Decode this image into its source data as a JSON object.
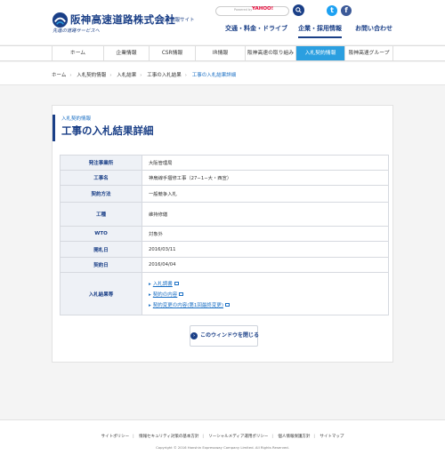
{
  "header": {
    "logo_name": "阪神高速道路株式会社",
    "logo_sub": "企業情報サイト",
    "logo_tag": "先進の道路サービスへ",
    "search_powered": "Powered by",
    "search_brand": "YAHOO!",
    "top_nav": [
      "交通・料金・ドライブ",
      "企業・採用情報",
      "お問い合わせ"
    ]
  },
  "global_nav": [
    {
      "label": "ホーム",
      "active": false
    },
    {
      "label": "企業情報",
      "active": false
    },
    {
      "label": "CSR情報",
      "active": false
    },
    {
      "label": "IR情報",
      "active": false
    },
    {
      "label": "阪神高速の取り組み",
      "active": false
    },
    {
      "label": "入札契約情報",
      "active": true
    },
    {
      "label": "阪神高速グループ",
      "active": false
    }
  ],
  "breadcrumb": [
    "ホーム",
    "入札契約情報",
    "入札結果",
    "工事の入札結果",
    "工事の入札結果詳細"
  ],
  "page": {
    "category": "入札契約情報",
    "title": "工事の入札結果詳細"
  },
  "details": [
    {
      "label": "発注事業所",
      "value": "大阪管理局"
    },
    {
      "label": "工事名",
      "value": "神扇線手摺修工事（27−1−大・西宣）"
    },
    {
      "label": "契約方法",
      "value": "一般競争入札"
    },
    {
      "label": "工種",
      "value": "維持修繕"
    },
    {
      "label": "WTO",
      "value": "対象外"
    },
    {
      "label": "開札日",
      "value": "2016/03/11"
    },
    {
      "label": "契約日",
      "value": "2016/04/04"
    }
  ],
  "results": {
    "label": "入札結果等",
    "links": [
      "入札調書",
      "契約の内容",
      "契約変更の内容(第1回最終変更)"
    ]
  },
  "close_label": "このウィンドウを閉じる",
  "footer": {
    "links": [
      "サイトポリシー",
      "情報セキュリティ対策の基本方針",
      "ソーシャルメディア運用ポリシー",
      "個人情報保護方針",
      "サイトマップ"
    ],
    "copyright": "Copyright © 2016 Hanshin Expressway Company Limited. All Rights Reserved."
  },
  "colors": {
    "brand": "#1a3f87",
    "accent": "#2b9fe0",
    "link": "#1a6fc4"
  }
}
